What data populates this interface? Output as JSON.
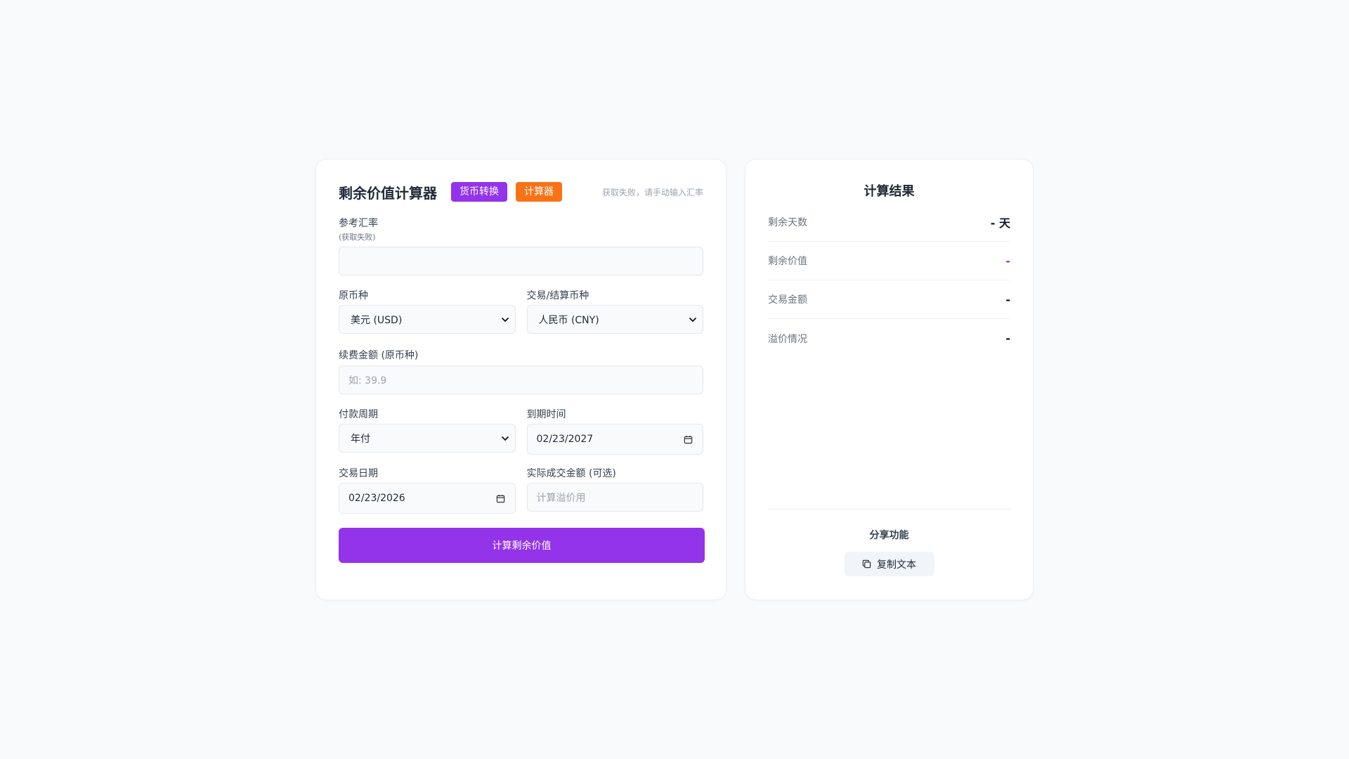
{
  "calculator": {
    "title": "剩余价值计算器",
    "tab_currency": "货币转换",
    "tab_calculator": "计算器",
    "rate_status": "获取失败，请手动输入汇率",
    "ref_rate_label": "参考汇率",
    "ref_rate_sub": "(获取失败)",
    "ref_rate_value": "",
    "source_currency_label": "原币种",
    "source_currency_value": "美元 (USD)",
    "target_currency_label": "交易/结算币种",
    "target_currency_value": "人民币 (CNY)",
    "renewal_label": "续费金额 (原币种)",
    "renewal_placeholder": "如: 39.9",
    "period_label": "付款周期",
    "period_value": "年付",
    "expiry_label": "到期时间",
    "expiry_value": "02/23/2027",
    "trade_date_label": "交易日期",
    "trade_date_value": "02/23/2026",
    "actual_amount_label": "实际成交金额 (可选)",
    "actual_amount_placeholder": "计算溢价用",
    "submit_label": "计算剩余价值"
  },
  "results": {
    "title": "计算结果",
    "rows": [
      {
        "label": "剩余天数",
        "value": "- 天"
      },
      {
        "label": "剩余价值",
        "value": "-"
      },
      {
        "label": "交易金额",
        "value": "-"
      },
      {
        "label": "溢价情况",
        "value": "-"
      }
    ],
    "share_title": "分享功能",
    "copy_label": "复制文本"
  },
  "colors": {
    "accent": "#9333ea",
    "orange": "#f97316"
  },
  "icons": {
    "chevron": "chevron-down-icon",
    "calendar": "calendar-icon",
    "copy": "copy-icon"
  }
}
